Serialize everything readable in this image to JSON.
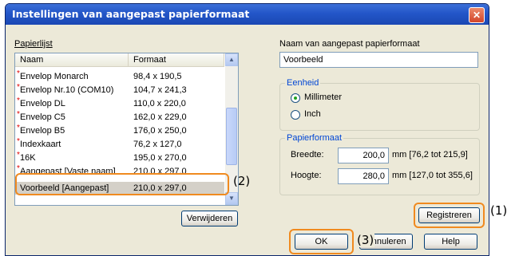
{
  "window": {
    "title": "Instellingen van aangepast papierformaat"
  },
  "paper_list": {
    "label": "Papierlijst",
    "columns": [
      "Naam",
      "Formaat"
    ],
    "rows": [
      {
        "name": "Envelop Monarch",
        "size": "98,4 x 190,5"
      },
      {
        "name": "Envelop Nr.10 (COM10)",
        "size": "104,7 x 241,3"
      },
      {
        "name": "Envelop DL",
        "size": "110,0 x 220,0"
      },
      {
        "name": "Envelop C5",
        "size": "162,0 x 229,0"
      },
      {
        "name": "Envelop B5",
        "size": "176,0 x 250,0"
      },
      {
        "name": "Indexkaart",
        "size": "76,2 x 127,0"
      },
      {
        "name": "16K",
        "size": "195,0 x 270,0"
      },
      {
        "name": "Aangepast [Vaste naam]",
        "size": "210,0 x 297,0"
      }
    ],
    "selected_row": {
      "name": "Voorbeeld [Aangepast]",
      "size": "210,0 x 297,0"
    },
    "delete_label": "Verwijderen"
  },
  "custom_name": {
    "label": "Naam van aangepast papierformaat",
    "value": "Voorbeeld"
  },
  "unit": {
    "label": "Eenheid",
    "options": [
      "Millimeter",
      "Inch"
    ],
    "selected": "Millimeter"
  },
  "paper_size": {
    "label": "Papierformaat",
    "width_label": "Breedte:",
    "width_value": "200,0",
    "width_range": "mm [76,2 tot 215,9]",
    "height_label": "Hoogte:",
    "height_value": "280,0",
    "height_range": "mm [127,0 tot 355,6]"
  },
  "buttons": {
    "register": "Registreren",
    "ok": "OK",
    "cancel": "Annuleren",
    "help": "Help"
  },
  "callouts": {
    "one": "(1)",
    "two": "(2)",
    "three": "(3)"
  },
  "colors": {
    "title_bar": "#2356c8",
    "highlight": "#f08a1f",
    "required_star": "#e00000"
  }
}
